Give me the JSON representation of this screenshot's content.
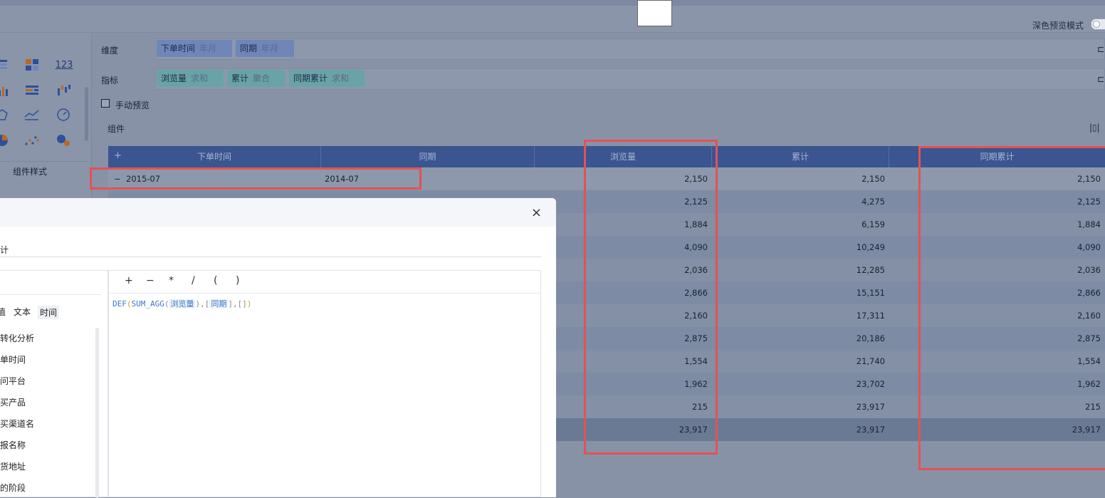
{
  "header": {
    "dark_preview_label": "深色预览模式"
  },
  "left_panel": {
    "palette_icons": [
      "table-icon",
      "cross-table-icon",
      "number-123-icon",
      "bar-chart-icon",
      "grouped-table-icon",
      "waterfall-icon",
      "radar-icon",
      "line-chart-icon",
      "gauge-icon",
      "pie-icon",
      "scatter-icon",
      "bubble-icon"
    ],
    "number_icon_text": "123",
    "style_tab": "组件样式"
  },
  "config": {
    "dimension_label": "维度",
    "dimension_chips": [
      {
        "name": "下单时间",
        "sub": "年月"
      },
      {
        "name": "同期",
        "sub": "年月"
      }
    ],
    "measure_label": "指标",
    "measure_chips": [
      {
        "name": "浏览量",
        "sub": "求和"
      },
      {
        "name": "累计",
        "sub": "聚合"
      },
      {
        "name": "同期累计",
        "sub": "求和"
      }
    ],
    "manual_preview": "手动预览",
    "component_label": "组件"
  },
  "table": {
    "columns": [
      "下单时间",
      "同期",
      "浏览量",
      "累计",
      "同期累计"
    ],
    "add_symbol": "+",
    "collapse_symbol": "−",
    "first_row": {
      "time": "2015-07",
      "period": "2014-07"
    },
    "rows": [
      {
        "views": "2,150",
        "cum": "2,150",
        "period_cum": "2,150"
      },
      {
        "views": "2,125",
        "cum": "4,275",
        "period_cum": "2,125"
      },
      {
        "views": "1,884",
        "cum": "6,159",
        "period_cum": "1,884"
      },
      {
        "views": "4,090",
        "cum": "10,249",
        "period_cum": "4,090"
      },
      {
        "views": "2,036",
        "cum": "12,285",
        "period_cum": "2,036"
      },
      {
        "views": "2,866",
        "cum": "15,151",
        "period_cum": "2,866"
      },
      {
        "views": "2,160",
        "cum": "17,311",
        "period_cum": "2,160"
      },
      {
        "views": "2,875",
        "cum": "20,186",
        "period_cum": "2,875"
      },
      {
        "views": "1,554",
        "cum": "21,740",
        "period_cum": "1,554"
      },
      {
        "views": "1,962",
        "cum": "23,702",
        "period_cum": "1,962"
      },
      {
        "views": "215",
        "cum": "23,917",
        "period_cum": "215"
      },
      {
        "views": "23,917",
        "cum": "23,917",
        "period_cum": "23,917"
      }
    ]
  },
  "dialog": {
    "close_symbol": "×",
    "name_fragment": "计",
    "operators": [
      "+",
      "−",
      "*",
      "/",
      "(",
      ")"
    ],
    "formula": {
      "fn1": "DEF",
      "fn2": "SUM_AGG",
      "field1": "浏览量",
      "field2": "同期",
      "tail": "[]"
    },
    "type_tabs": [
      "值",
      "文本",
      "时间"
    ],
    "fields": [
      "转化分析",
      "单时间",
      "问平台",
      "买产品",
      "买渠道名",
      "报名称",
      "货地址",
      "的阶段"
    ]
  }
}
